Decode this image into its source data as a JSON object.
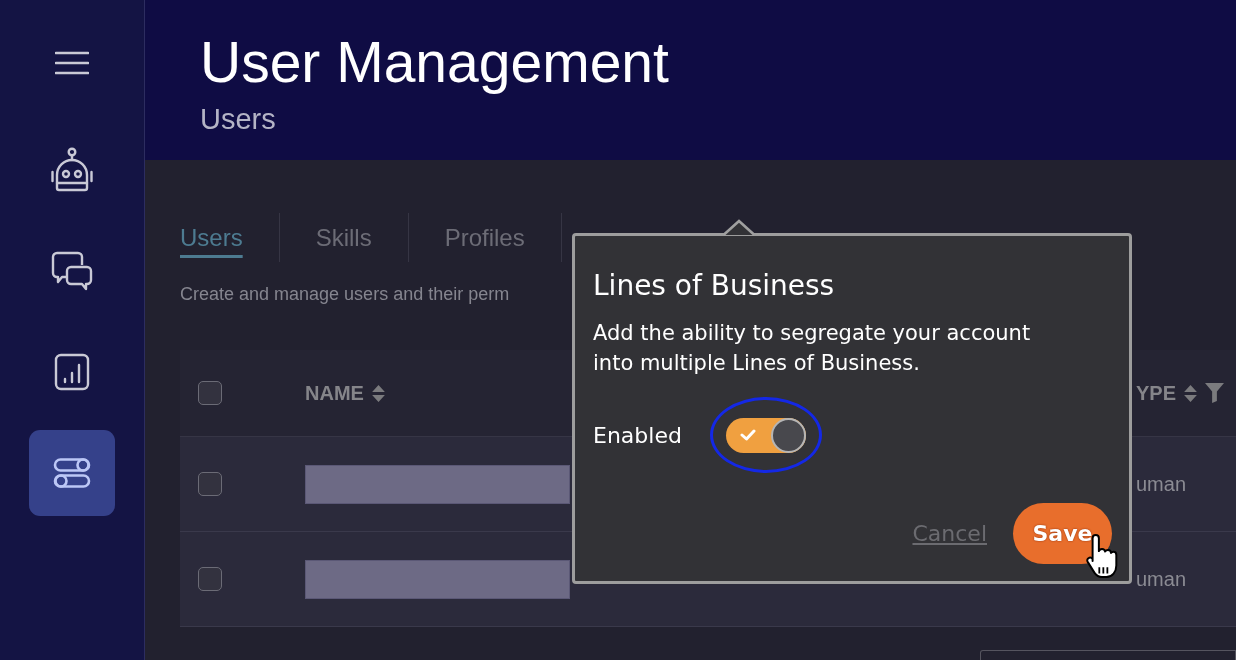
{
  "sidebar": {
    "items": [
      {
        "kind": "robot",
        "selected": false
      },
      {
        "kind": "chat",
        "selected": false
      },
      {
        "kind": "chart",
        "selected": false
      },
      {
        "kind": "toggles",
        "selected": true
      }
    ]
  },
  "header": {
    "title": "User Management",
    "subtitle": "Users"
  },
  "tabs": [
    {
      "label": "Users",
      "selected": true
    },
    {
      "label": "Skills",
      "selected": false
    },
    {
      "label": "Profiles",
      "selected": false
    }
  ],
  "description": "Create and manage users and their perm",
  "table": {
    "select_all": {
      "checked": false
    },
    "columns": [
      {
        "label": "NAME",
        "sortable": true,
        "filterable": false
      },
      {
        "label": "YPE",
        "sortable": true,
        "filterable": true
      }
    ],
    "rows": [
      {
        "checked": false,
        "cells": [
          {
            "kind": "redacted"
          },
          {
            "kind": "text",
            "text": "uman"
          }
        ]
      },
      {
        "checked": false,
        "cells": [
          {
            "kind": "redacted"
          },
          {
            "kind": "text",
            "text": "uman"
          }
        ]
      }
    ]
  },
  "dialog": {
    "title": "Lines of Business",
    "text": "Add the ability to segregate your account into multiple Lines of Business.",
    "toggle": {
      "label": "Enabled",
      "on": true,
      "focused": true
    },
    "buttons": [
      {
        "label": "Cancel",
        "kind": "link",
        "hovered": false
      },
      {
        "label": "Save",
        "kind": "primary",
        "hovered": true
      }
    ]
  }
}
